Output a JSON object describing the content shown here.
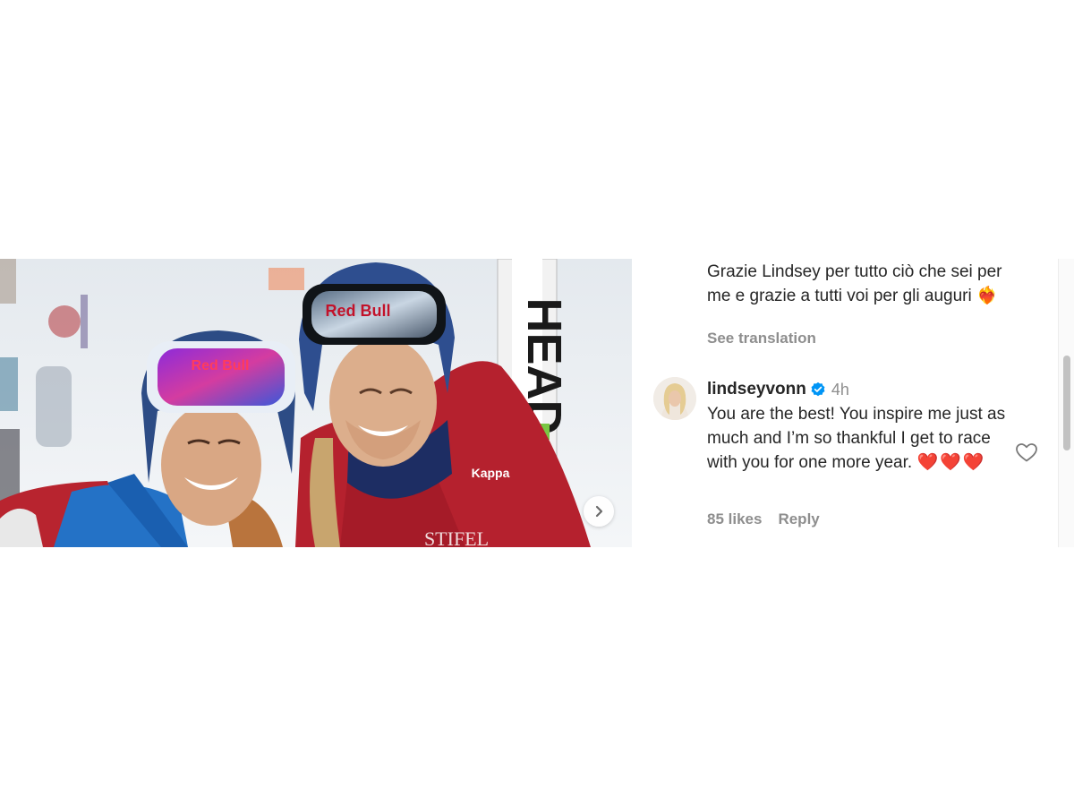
{
  "post": {
    "caption": "Grazie Lindsey per tutto ciò che sei per me e grazie a tutti voi per gli auguri",
    "caption_emoji": "❤️‍🔥",
    "see_translation_label": "See translation"
  },
  "photo": {
    "goggle_brand_left": "Red Bull",
    "goggle_brand_right": "Red Bull",
    "ski_brand": "HEAD",
    "jacket_text": "STIFEL"
  },
  "comment": {
    "username": "lindseyvonn",
    "verified": true,
    "time": "4h",
    "text": "You are the best! You inspire me just as much and I’m so thankful I get to race with you for one more year.",
    "emojis": "❤️❤️❤️",
    "likes_label": "85 likes",
    "reply_label": "Reply"
  },
  "icons": {
    "next": "chevron-right-icon",
    "like": "heart-outline-icon",
    "verified": "verified-badge-icon"
  },
  "colors": {
    "text": "#262626",
    "secondary": "#8e8e8e",
    "verified_blue": "#0095f6",
    "heart_red": "#e0212c"
  }
}
